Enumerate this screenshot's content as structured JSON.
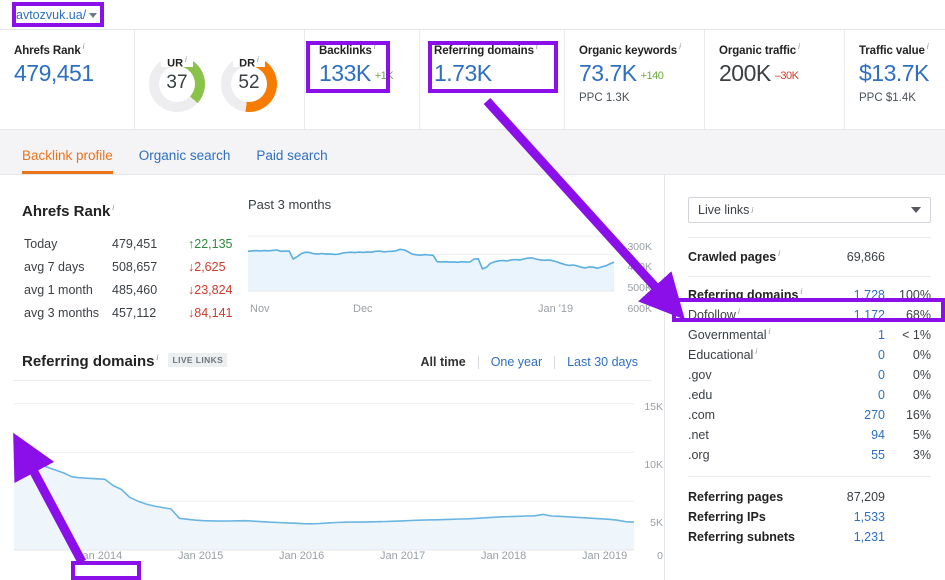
{
  "urlbar": {
    "site": "avtozvuk.ua/",
    "caret_icon": "chevron-down-icon"
  },
  "metrics": [
    {
      "label": "Ahrefs Rank",
      "value": "479,451"
    },
    {
      "label": "UR",
      "value": "37",
      "color": "#8bc34a"
    },
    {
      "label": "DR",
      "value": "52",
      "color": "#f57c00"
    },
    {
      "label": "Backlinks",
      "value": "133K",
      "delta": "+1K",
      "delta_dir": "up"
    },
    {
      "label": "Referring domains",
      "value": "1.73K"
    },
    {
      "label": "Organic keywords",
      "value": "73.7K",
      "delta": "+140",
      "delta_dir": "up",
      "sub": "PPC 1.3K"
    },
    {
      "label": "Organic traffic",
      "value": "200K",
      "delta": "–30K",
      "delta_dir": "down"
    },
    {
      "label": "Traffic value",
      "value": "$13.7K",
      "sub": "PPC $1.4K"
    }
  ],
  "tabs": [
    {
      "label": "Backlink profile",
      "active": true
    },
    {
      "label": "Organic search",
      "active": false
    },
    {
      "label": "Paid search",
      "active": false
    }
  ],
  "ahrefs_rank": {
    "title": "Ahrefs Rank",
    "rows": [
      {
        "label": "Today",
        "value": "479,451",
        "delta": "22,135",
        "dir": "up"
      },
      {
        "label": "avg 7 days",
        "value": "508,657",
        "delta": "2,625",
        "dir": "down"
      },
      {
        "label": "avg 1 month",
        "value": "485,460",
        "delta": "23,824",
        "dir": "down"
      },
      {
        "label": "avg 3 months",
        "value": "457,112",
        "delta": "84,141",
        "dir": "down"
      }
    ]
  },
  "referring_domains_section": {
    "title": "Referring domains",
    "badge": "LIVE LINKS",
    "ranges": [
      {
        "label": "All time",
        "active": true
      },
      {
        "label": "One year",
        "active": false
      },
      {
        "label": "Last 30 days",
        "active": false
      }
    ]
  },
  "right_panel": {
    "select_value": "Live links",
    "select_caret_icon": "chevron-down-icon",
    "crawled": {
      "label": "Crawled pages",
      "value": "69,866"
    },
    "breakdown": [
      {
        "label": "Referring domains",
        "value": "1,728",
        "pct": "100%",
        "bold": true,
        "info": true
      },
      {
        "label": "Dofollow",
        "value": "1,172",
        "pct": "68%",
        "bold": false,
        "info": true,
        "highlight": true
      },
      {
        "label": "Governmental",
        "value": "1",
        "pct": "< 1%",
        "bold": false,
        "info": true
      },
      {
        "label": "Educational",
        "value": "0",
        "pct": "0%",
        "bold": false,
        "info": true
      },
      {
        "label": ".gov",
        "value": "0",
        "pct": "0%",
        "bold": false,
        "info": false
      },
      {
        "label": ".edu",
        "value": "0",
        "pct": "0%",
        "bold": false,
        "info": false
      },
      {
        "label": ".com",
        "value": "270",
        "pct": "16%",
        "bold": false,
        "info": false
      },
      {
        "label": ".net",
        "value": "94",
        "pct": "5%",
        "bold": false,
        "info": false
      },
      {
        "label": ".org",
        "value": "55",
        "pct": "3%",
        "bold": false,
        "info": false
      }
    ],
    "totals": [
      {
        "label": "Referring pages",
        "value": "87,209"
      },
      {
        "label": "Referring IPs",
        "value": "1,533"
      },
      {
        "label": "Referring subnets",
        "value": "1,231"
      }
    ]
  },
  "annotations": {
    "color": "#8a0fe8",
    "boxes": [
      "url-box",
      "backlinks-box",
      "referring-domains-box",
      "dofollow-row-box",
      "jan2014-box"
    ],
    "arrows": [
      "arrow-to-dofollow",
      "arrow-to-jan2014"
    ]
  },
  "chart_data": [
    {
      "id": "ahrefs-rank-3months",
      "type": "line",
      "title": "Past 3 months",
      "xlabel": "",
      "ylabel": "",
      "inverted_y": true,
      "ylim": [
        600000,
        250000
      ],
      "ytick_labels": [
        "300K",
        "400K",
        "500K",
        "600K"
      ],
      "yticks": [
        300000,
        400000,
        500000,
        600000
      ],
      "xtick_labels": [
        "Nov",
        "Dec",
        "Jan '19"
      ],
      "grid": true,
      "legend": "none",
      "line_color": "#5aaee0",
      "fill_color": "#eaf4fc",
      "x": [
        0,
        1,
        2,
        3,
        4,
        5,
        6,
        7,
        8,
        9,
        10,
        11,
        12,
        13,
        14,
        15,
        16,
        17,
        18,
        19,
        20,
        21,
        22,
        23,
        24,
        25,
        26,
        27,
        28,
        29,
        30,
        31,
        32,
        33,
        34,
        35,
        36,
        37,
        38,
        39,
        40,
        41,
        42,
        43,
        44,
        45,
        46,
        47,
        48,
        49,
        50,
        51,
        52,
        53,
        54,
        55,
        56,
        57,
        58,
        59,
        60,
        61,
        62,
        63,
        64,
        65,
        66,
        67,
        68,
        69,
        70,
        71,
        72,
        73,
        74,
        75,
        76,
        77,
        78,
        79,
        80,
        81,
        82,
        83,
        84,
        85,
        86,
        87,
        88,
        89
      ],
      "values": [
        383000,
        380000,
        379000,
        381000,
        379000,
        380000,
        378000,
        376000,
        383000,
        382000,
        381000,
        425000,
        412000,
        395000,
        388000,
        390000,
        396000,
        398000,
        395000,
        398000,
        397000,
        400000,
        399000,
        392000,
        390000,
        388000,
        390000,
        387000,
        389000,
        386000,
        388000,
        383000,
        381000,
        386000,
        384000,
        383000,
        380000,
        372000,
        376000,
        386000,
        399000,
        402000,
        404000,
        401000,
        403000,
        405000,
        440000,
        441000,
        440000,
        442000,
        441000,
        443000,
        440000,
        442000,
        441000,
        425000,
        424000,
        479000,
        470000,
        448000,
        440000,
        435000,
        433000,
        436000,
        430000,
        428000,
        431000,
        425000,
        420000,
        419000,
        425000,
        430000,
        432000,
        430000,
        434000,
        440000,
        448000,
        455000,
        460000,
        458000,
        462000,
        470000,
        474000,
        468000,
        470000,
        476000,
        468000,
        462000,
        452000,
        442000
      ]
    },
    {
      "id": "referring-domains-alltime",
      "type": "area",
      "title": "Referring domains",
      "xlabel": "",
      "ylabel": "",
      "ylim": [
        0,
        16500
      ],
      "ytick_labels": [
        "15K",
        "10K",
        "5K",
        "0"
      ],
      "yticks": [
        15000,
        10000,
        5000,
        0
      ],
      "xtick_labels": [
        "Jan 2014",
        "Jan 2015",
        "Jan 2016",
        "Jan 2017",
        "Jan 2018",
        "Jan 2019"
      ],
      "grid": true,
      "legend": "none",
      "line_color": "#6bb5e2",
      "fill_color": "#eef6fc",
      "x": [
        0,
        1,
        2,
        3,
        4,
        5,
        6,
        7,
        8,
        9,
        10,
        11,
        12,
        13,
        14,
        15,
        16,
        17,
        18,
        19,
        20,
        21,
        22,
        23,
        24,
        25,
        26,
        27,
        28,
        29,
        30,
        31,
        32,
        33,
        34,
        35,
        36,
        37,
        38,
        39,
        40,
        41,
        42,
        43,
        44,
        45,
        46,
        47,
        48,
        49,
        50,
        51,
        52,
        53,
        54,
        55,
        56,
        57,
        58,
        59,
        60,
        61,
        62,
        63,
        64,
        65,
        66,
        67,
        68,
        69,
        70,
        71,
        72,
        73,
        74,
        75
      ],
      "values": [
        9900,
        9600,
        9200,
        8800,
        8500,
        8200,
        7900,
        7500,
        7400,
        7350,
        7300,
        7250,
        6600,
        6200,
        5400,
        5000,
        4700,
        4500,
        4350,
        4200,
        3250,
        3150,
        3050,
        3000,
        2980,
        2960,
        2970,
        2990,
        3000,
        2950,
        2900,
        2850,
        2820,
        2780,
        2750,
        2700,
        2680,
        2720,
        2780,
        2820,
        2850,
        2870,
        2860,
        2880,
        2900,
        2920,
        2950,
        2980,
        3020,
        3050,
        3080,
        3100,
        3120,
        3150,
        3180,
        3200,
        3250,
        3300,
        3350,
        3400,
        3420,
        3450,
        3480,
        3500,
        3650,
        3480,
        3450,
        3400,
        3350,
        3300,
        3250,
        3200,
        3150,
        3050,
        2900,
        2850
      ]
    }
  ]
}
